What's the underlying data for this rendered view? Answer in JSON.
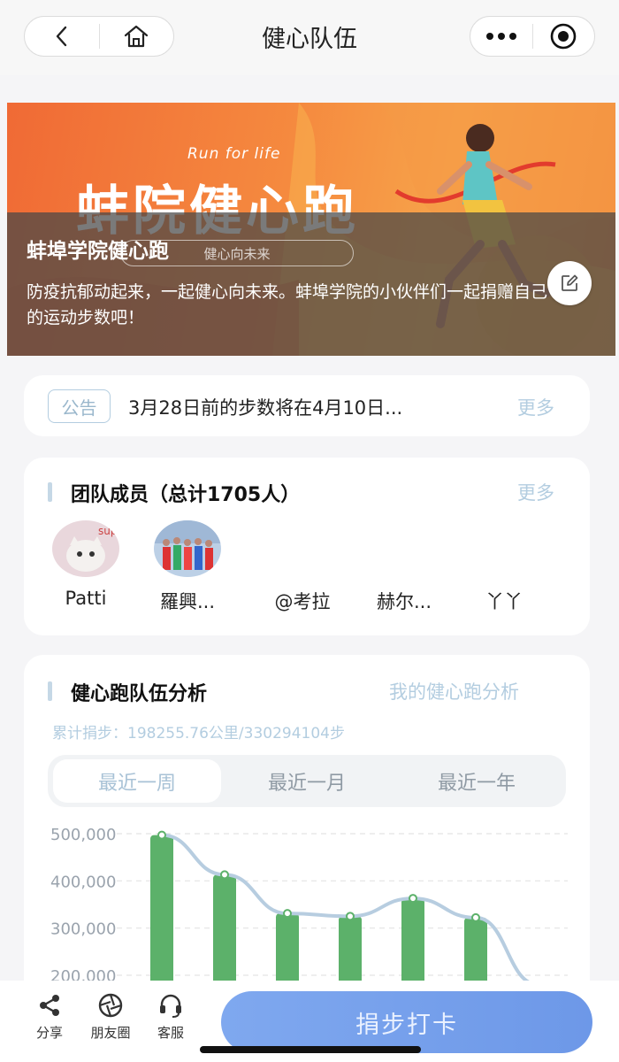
{
  "nav": {
    "title": "健心队伍",
    "back_icon": "chevron-left-icon",
    "home_icon": "home-icon",
    "more_icon": "more-dots-icon",
    "target_icon": "target-icon"
  },
  "banner": {
    "tagline": "Run for life",
    "big_title": "蚌院健心跑",
    "slogan_chip": "健心向未来",
    "heading": "蚌埠学院健心跑",
    "description": "防疫抗郁动起来，一起健心向未来。蚌埠学院的小伙伴们一起捐赠自己的运动步数吧！",
    "edit_icon": "edit-icon"
  },
  "notice": {
    "badge": "公告",
    "text": "3月28日前的步数将在4月10日...",
    "more": "更多"
  },
  "members": {
    "title": "团队成员（总计1705人）",
    "more": "更多",
    "list": [
      {
        "name": "Patti"
      },
      {
        "name": "羅興..."
      },
      {
        "name": "@考拉"
      },
      {
        "name": "赫尔..."
      },
      {
        "name": "丫丫"
      }
    ]
  },
  "analysis": {
    "title": "健心跑队伍分析",
    "my_link": "我的健心跑分析",
    "subtitle": "累计捐步：198255.76公里/330294104步",
    "tabs": [
      {
        "label": "最近一周",
        "active": true
      },
      {
        "label": "最近一月",
        "active": false
      },
      {
        "label": "最近一年",
        "active": false
      }
    ]
  },
  "chart_data": {
    "type": "bar",
    "y_ticks": [
      "500,000",
      "400,000",
      "300,000",
      "200,000"
    ],
    "ylim": [
      200000,
      500000
    ],
    "values": [
      497000,
      413000,
      331000,
      325000,
      363000,
      322000,
      null
    ],
    "trend_line": [
      497000,
      413000,
      331000,
      325000,
      363000,
      322000,
      180000
    ],
    "bar_color": "#5cb16a",
    "line_color": "#b7cde0"
  },
  "bottom": {
    "share": "分享",
    "moments": "朋友圈",
    "service": "客服",
    "checkin": "捐步打卡"
  }
}
